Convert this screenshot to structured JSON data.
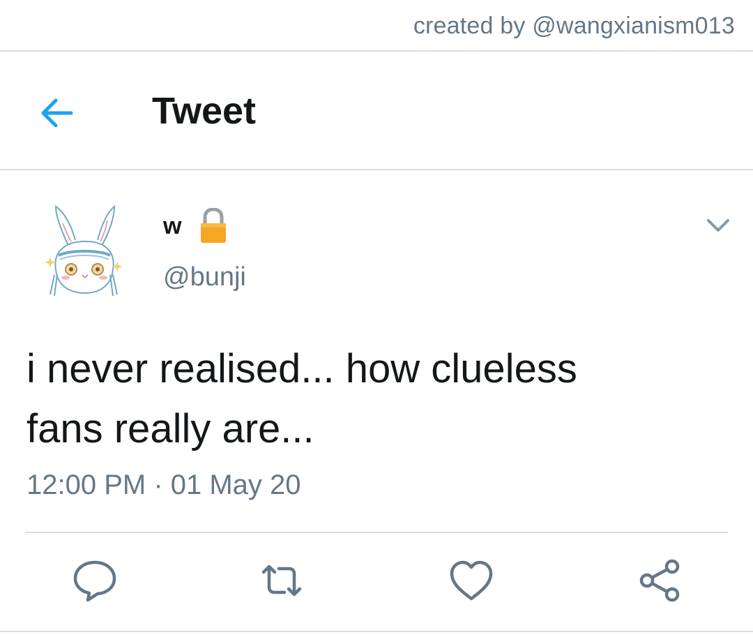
{
  "credit": "created by @wangxianism013",
  "header": {
    "title": "Tweet",
    "back_icon": "arrow-left-icon"
  },
  "tweet": {
    "display_name": "w",
    "protected_icon": "lock-icon",
    "handle": "@bunji",
    "text_line1": "i never realised... how clueless",
    "text_line2": "fans really are...",
    "timestamp": "12:00 PM · 01 May 20",
    "menu_icon": "chevron-down-icon"
  },
  "actions": [
    {
      "icon": "reply-icon"
    },
    {
      "icon": "retweet-icon"
    },
    {
      "icon": "like-icon"
    },
    {
      "icon": "share-icon"
    }
  ],
  "colors": {
    "accent": "#1da1f2",
    "text": "#14171a",
    "secondary": "#657786",
    "divider": "#d9dee2",
    "lock": "#f5a623"
  }
}
